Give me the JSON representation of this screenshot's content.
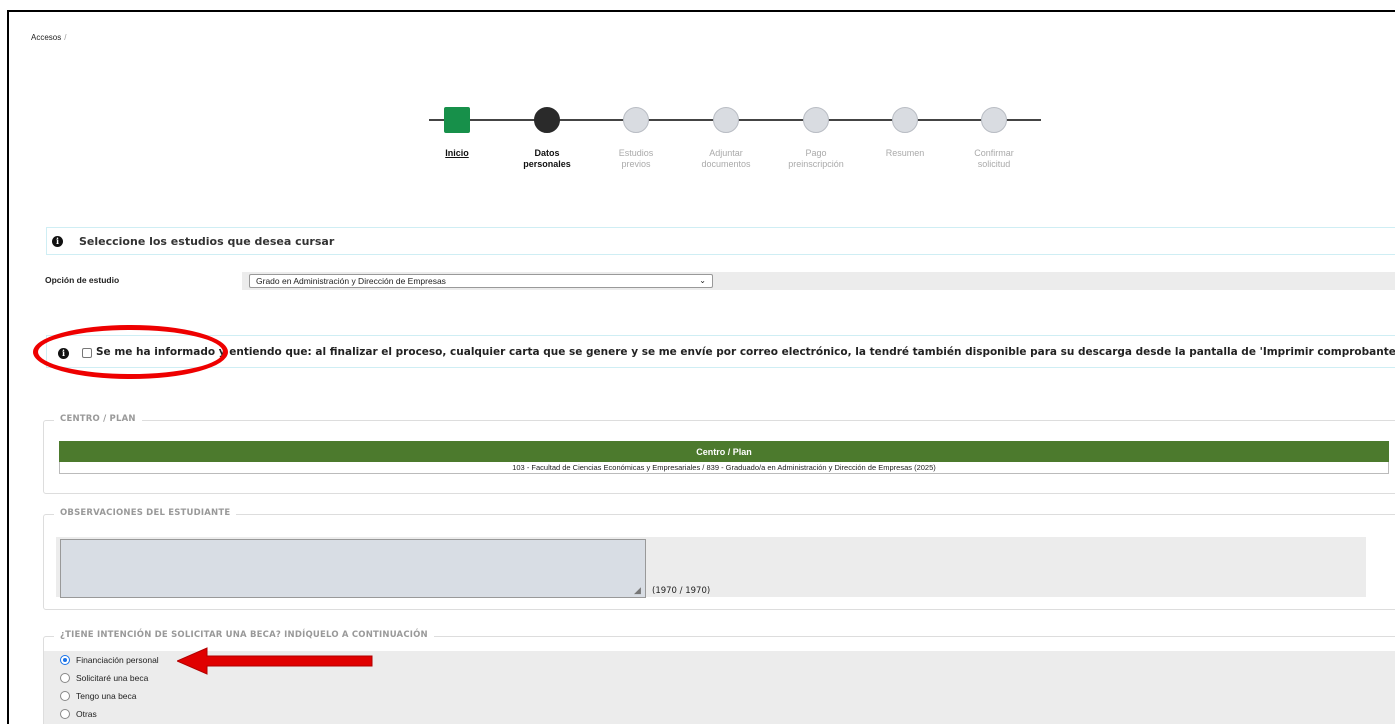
{
  "breadcrumb": {
    "item": "Accesos",
    "separator": "/"
  },
  "stepper": {
    "steps": [
      {
        "label": "Inicio",
        "state": "done"
      },
      {
        "label": "Datos\npersonales",
        "state": "current"
      },
      {
        "label": "Estudios\nprevios",
        "state": "pending"
      },
      {
        "label": "Adjuntar\ndocumentos",
        "state": "pending"
      },
      {
        "label": "Pago\npreinscripción",
        "state": "pending"
      },
      {
        "label": "Resumen",
        "state": "pending"
      },
      {
        "label": "Confirmar\nsolicitud",
        "state": "pending"
      }
    ],
    "colors": {
      "done": "#17904a",
      "current": "#2a2a2a",
      "pending": "#d9dce1"
    }
  },
  "info_message": "Seleccione los estudios que desea cursar",
  "study_option": {
    "label": "Opción de estudio",
    "selected": "Grado en Administración y Dirección de Empresas"
  },
  "acknowledgement": {
    "checked": false,
    "text": "Se me ha informado y entiendo que: al finalizar el proceso, cualquier carta que se genere y se me envíe por correo electrónico, la tendré también disponible para su descarga desde la pantalla de 'Imprimir comprobantes' de la inscripción."
  },
  "centro_plan": {
    "legend": "CENTRO / PLAN",
    "header": "Centro / Plan",
    "rows": [
      "103 - Facultad de Ciencias Económicas y Empresariales / 839 - Graduado/a en Administración y Dirección de Empresas (2025)"
    ],
    "header_color": "#4c7a2d"
  },
  "observaciones": {
    "legend": "OBSERVACIONES DEL ESTUDIANTE",
    "value": "",
    "counter": "(1970 / 1970)"
  },
  "beca": {
    "legend": "¿TIENE INTENCIÓN DE SOLICITAR UNA BECA? INDÍQUELO A CONTINUACIÓN",
    "options": [
      {
        "label": "Financiación personal",
        "selected": true
      },
      {
        "label": "Solicitaré una beca",
        "selected": false
      },
      {
        "label": "Tengo una beca",
        "selected": false
      },
      {
        "label": "Otras",
        "selected": false
      }
    ]
  },
  "annotation_color": "#e00000"
}
